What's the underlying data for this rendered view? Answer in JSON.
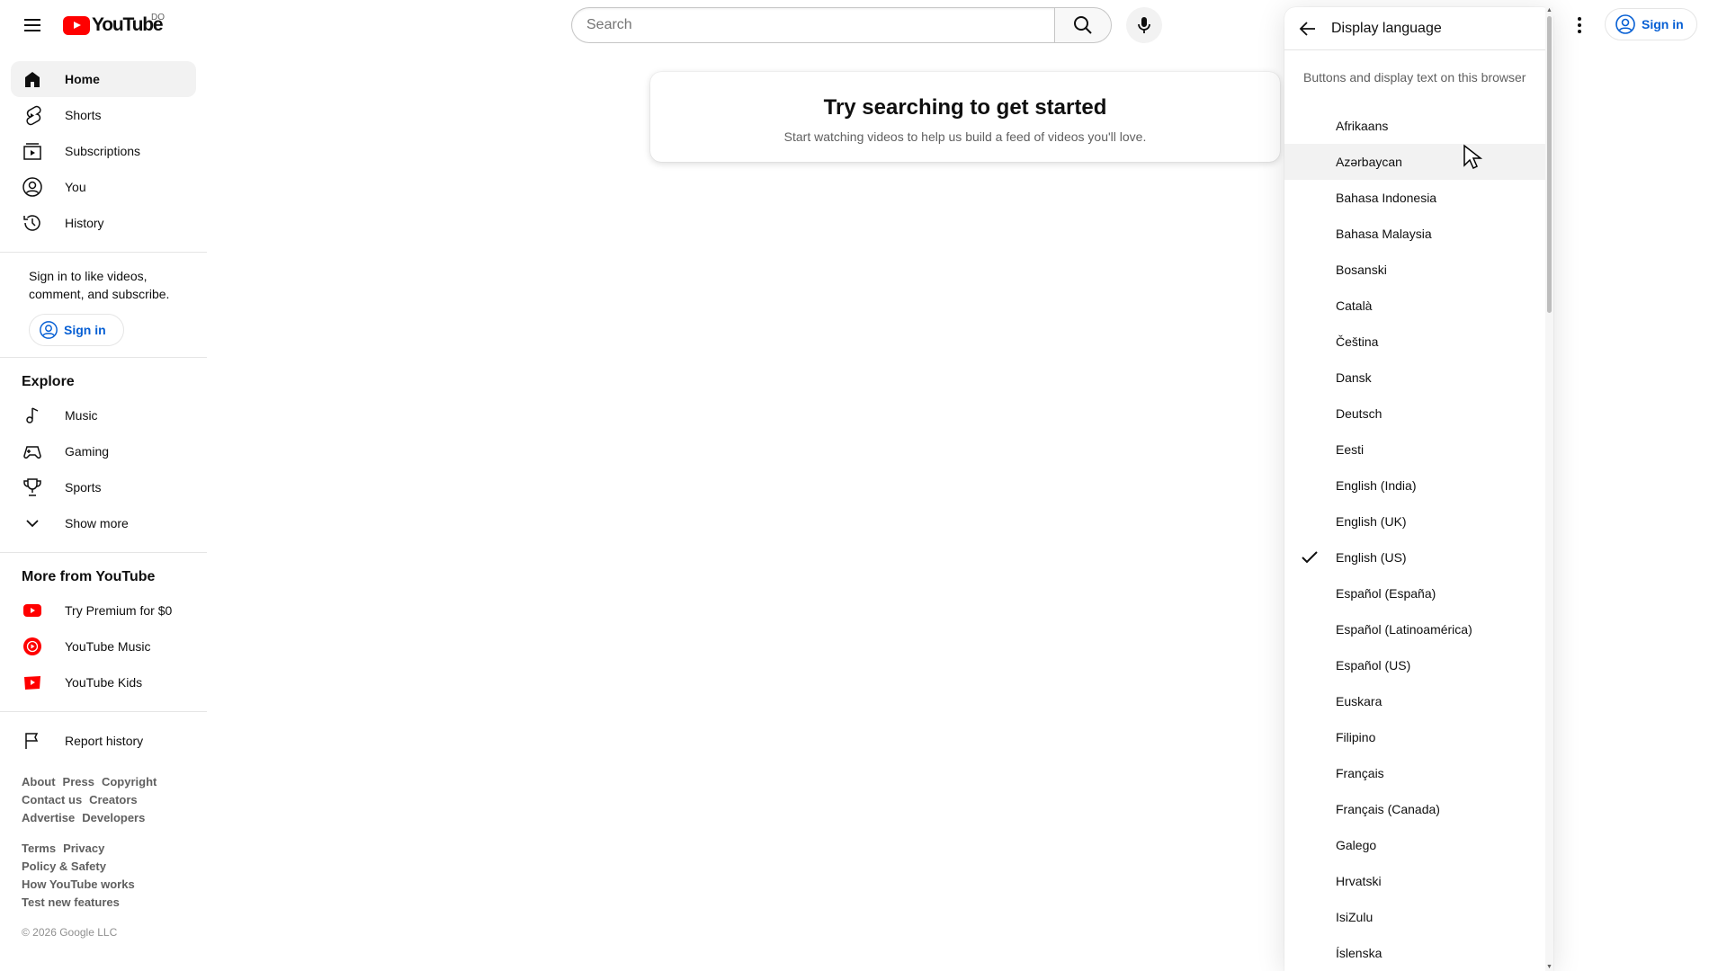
{
  "header": {
    "logo_text": "YouTube",
    "country_code": "DO",
    "search_placeholder": "Search",
    "signin_label": "Sign in"
  },
  "sidebar": {
    "main_items": [
      {
        "label": "Home",
        "icon": "home-icon",
        "active": true
      },
      {
        "label": "Shorts",
        "icon": "shorts-icon"
      },
      {
        "label": "Subscriptions",
        "icon": "subscriptions-icon"
      },
      {
        "label": "You",
        "icon": "you-icon"
      },
      {
        "label": "History",
        "icon": "history-icon"
      }
    ],
    "signin_note": "Sign in to like videos, comment, and subscribe.",
    "signin_label": "Sign in",
    "explore_title": "Explore",
    "explore_items": [
      {
        "label": "Music",
        "icon": "music-icon"
      },
      {
        "label": "Gaming",
        "icon": "gaming-icon"
      },
      {
        "label": "Sports",
        "icon": "sports-icon"
      },
      {
        "label": "Show more",
        "icon": "chevron-down-icon"
      }
    ],
    "more_title": "More from YouTube",
    "more_items": [
      {
        "label": "Try Premium for $0",
        "icon": "youtube-premium-icon"
      },
      {
        "label": "YouTube Music",
        "icon": "youtube-music-icon"
      },
      {
        "label": "YouTube Kids",
        "icon": "youtube-kids-icon"
      }
    ],
    "report_history": "Report history",
    "footer_row1": [
      "About",
      "Press",
      "Copyright"
    ],
    "footer_row2": [
      "Contact us",
      "Creators"
    ],
    "footer_row3": [
      "Advertise",
      "Developers"
    ],
    "footer_row4": [
      "Terms",
      "Privacy"
    ],
    "footer_row5": [
      "Policy & Safety"
    ],
    "footer_row6": [
      "How YouTube works"
    ],
    "footer_row7": [
      "Test new features"
    ],
    "copyright": "© 2026 Google LLC"
  },
  "main": {
    "title": "Try searching to get started",
    "subtitle": "Start watching videos to help us build a feed of videos you'll love."
  },
  "language_panel": {
    "title": "Display language",
    "description": "Buttons and display text on this browser",
    "selected": "English (US)",
    "hovered": "Azərbaycan",
    "languages": [
      "Afrikaans",
      "Azərbaycan",
      "Bahasa Indonesia",
      "Bahasa Malaysia",
      "Bosanski",
      "Català",
      "Čeština",
      "Dansk",
      "Deutsch",
      "Eesti",
      "English (India)",
      "English (UK)",
      "English (US)",
      "Español (España)",
      "Español (Latinoamérica)",
      "Español (US)",
      "Euskara",
      "Filipino",
      "Français",
      "Français (Canada)",
      "Galego",
      "Hrvatski",
      "IsiZulu",
      "Íslenska"
    ]
  },
  "colors": {
    "brand_red": "#ff0000",
    "link_blue": "#065fd4",
    "hover_gray": "#f2f2f2"
  }
}
